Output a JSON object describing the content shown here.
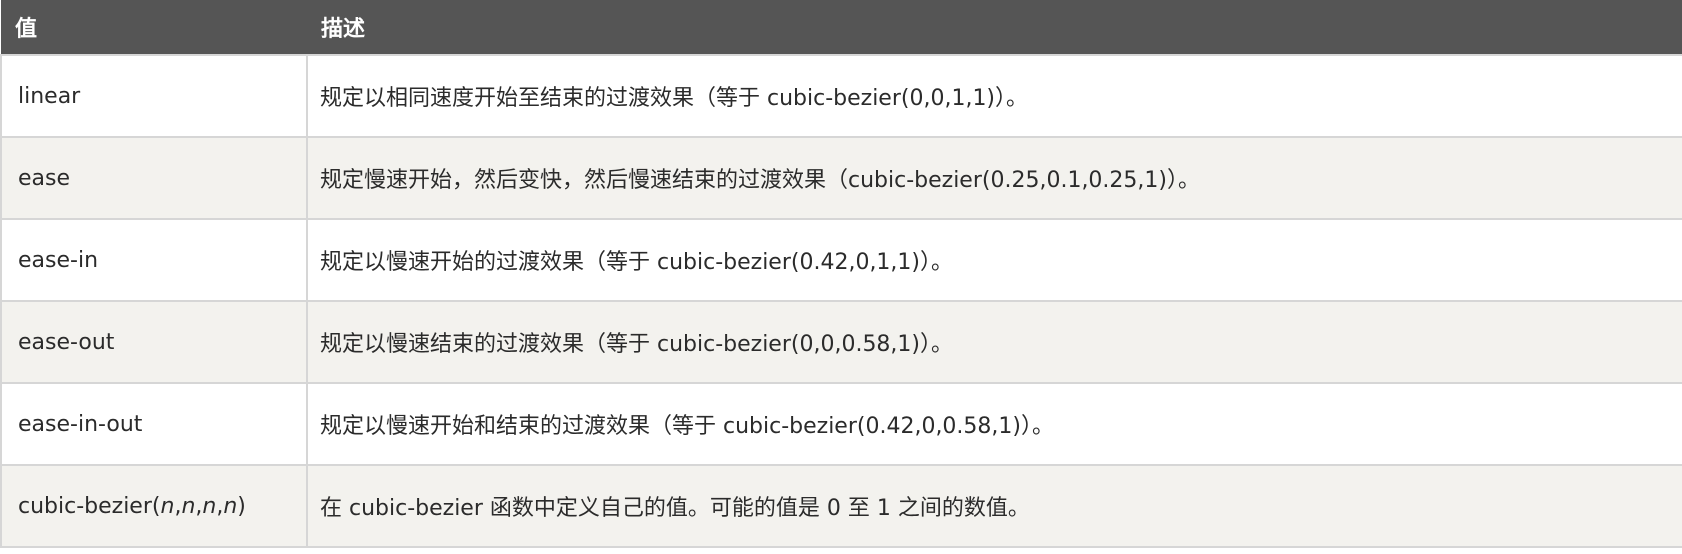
{
  "table": {
    "headers": [
      "值",
      "描述"
    ],
    "rows": [
      {
        "value": "linear",
        "description": "规定以相同速度开始至结束的过渡效果（等于 cubic-bezier(0,0,1,1)）。"
      },
      {
        "value": "ease",
        "description": "规定慢速开始，然后变快，然后慢速结束的过渡效果（cubic-bezier(0.25,0.1,0.25,1)）。"
      },
      {
        "value": "ease-in",
        "description": "规定以慢速开始的过渡效果（等于 cubic-bezier(0.42,0,1,1)）。"
      },
      {
        "value": "ease-out",
        "description": "规定以慢速结束的过渡效果（等于 cubic-bezier(0,0,0.58,1)）。"
      },
      {
        "value": "ease-in-out",
        "description": "规定以慢速开始和结束的过渡效果（等于 cubic-bezier(0.42,0,0.58,1)）。"
      },
      {
        "value_prefix": "cubic-bezier(",
        "value_args": [
          "n",
          "n",
          "n",
          "n"
        ],
        "value_suffix": ")",
        "description": "在 cubic-bezier 函数中定义自己的值。可能的值是 0 至 1 之间的数值。"
      }
    ]
  },
  "colors": {
    "header_bg": "#555555",
    "header_text": "#ffffff",
    "row_alt_bg": "#f3f2ee",
    "border": "#d6d6d6"
  }
}
